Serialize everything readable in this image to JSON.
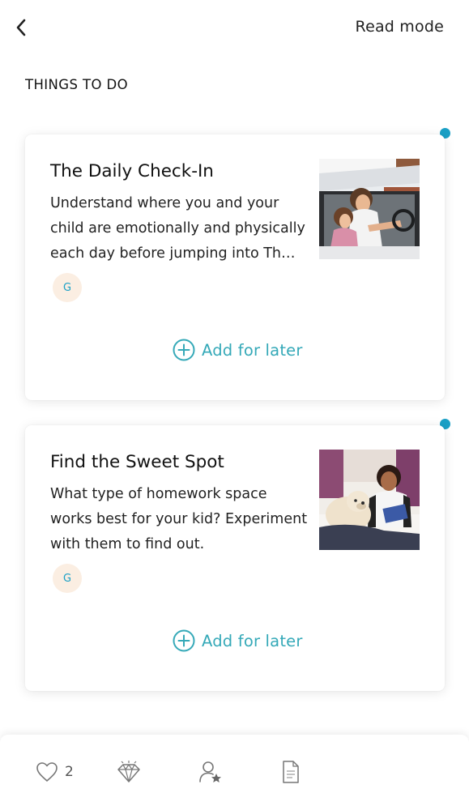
{
  "header": {
    "back_icon": "chevron-left-icon",
    "read_mode_label": "Read mode"
  },
  "section": {
    "title": "THINGS TO DO"
  },
  "cards": [
    {
      "title": "The Daily Check-In",
      "description": "Understand where you and your child are emotionally and physically each day before jumping into Th…",
      "badge": "G",
      "action_label": "Add for later",
      "action_icon": "plus-circle-icon",
      "image": "mother-and-daughter-in-car-photo",
      "unread": true
    },
    {
      "title": "Find the Sweet Spot",
      "description": "What type of homework space works best for your kid? Experiment with them to find out.",
      "badge": "G",
      "action_label": "Add for later",
      "action_icon": "plus-circle-icon",
      "image": "girl-with-dog-doing-homework-photo",
      "unread": true
    }
  ],
  "bottom_bar": {
    "like_icon": "heart-icon",
    "like_count": "2",
    "diamond_icon": "diamond-icon",
    "user_icon": "user-star-icon",
    "doc_icon": "document-icon"
  },
  "colors": {
    "accent": "#35a9b8",
    "unread_dot": "#1aa0c6",
    "badge_bg": "#fbeee2",
    "badge_text": "#1aa0c6"
  }
}
